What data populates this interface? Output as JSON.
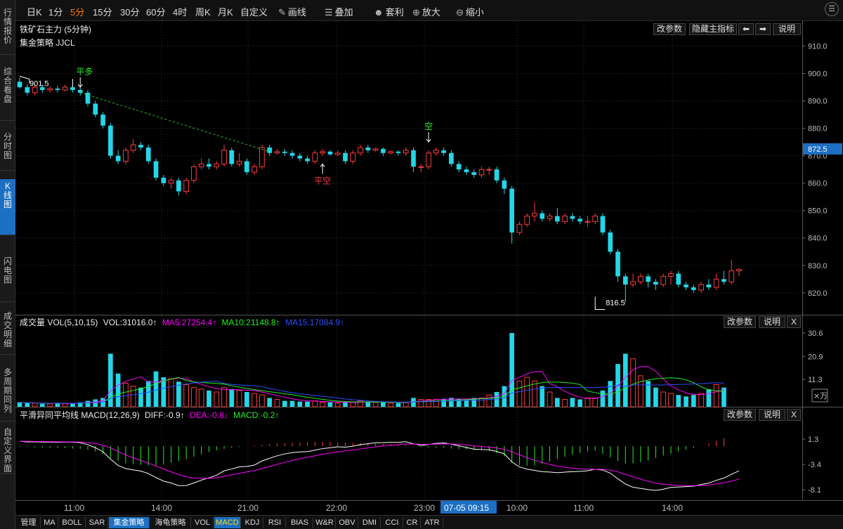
{
  "nav": {
    "tabs": [
      {
        "label": "行情报价",
        "active": false
      },
      {
        "label": "综合看盘",
        "active": false
      },
      {
        "label": "分时图",
        "active": false
      },
      {
        "label": "K线图",
        "active": true
      },
      {
        "label": "闪电图",
        "active": false
      },
      {
        "label": "成交明细",
        "active": false
      },
      {
        "label": "多周期同列",
        "active": false
      },
      {
        "label": "自定义界面",
        "active": false
      }
    ]
  },
  "toolbar": {
    "periods": [
      "日K",
      "1分",
      "5分",
      "15分",
      "30分",
      "60分",
      "4时",
      "周K",
      "月K",
      "自定义"
    ],
    "selected_period": "5分",
    "tools": [
      {
        "label": "画线",
        "icon": "pencil-icon",
        "glyph": "✎"
      },
      {
        "label": "叠加",
        "icon": "layers-icon",
        "glyph": "☰"
      },
      {
        "label": "套利",
        "icon": "arbitrage-icon",
        "glyph": "☻"
      },
      {
        "label": "放大",
        "icon": "zoom-in-icon",
        "glyph": "⊕"
      },
      {
        "label": "缩小",
        "icon": "zoom-out-icon",
        "glyph": "⊖"
      }
    ],
    "menu_glyph": "☰"
  },
  "main_panel": {
    "title": "铁矿石主力 (5分钟)",
    "strategy": "集金策略 JJCL",
    "buttons": {
      "params": "改参数",
      "hide": "隐藏主指标",
      "left": "⬅",
      "right": "➡",
      "help": "说明"
    },
    "y_ticks": [
      "910.0",
      "900.0",
      "890.0",
      "880.0",
      "870.0",
      "860.0",
      "850.0",
      "840.0",
      "830.0",
      "820.0"
    ],
    "current_price": "872.5",
    "high_label": "901.5",
    "low_label": "816.5",
    "signals": [
      "平多",
      "平空",
      "空"
    ]
  },
  "vol_panel": {
    "label": "成交量 VOL(5,10,15)",
    "vol": "VOL:31016.0↑",
    "ma5": "MA5:27254.4↑",
    "ma10": "MA10:21148.8↑",
    "ma15": "MA15:17084.9↑",
    "buttons": {
      "params": "改参数",
      "help": "说明",
      "close": "X"
    },
    "y_ticks": [
      "30.6",
      "20.9",
      "11.3"
    ],
    "unit": "×万"
  },
  "macd_panel": {
    "label": "平滑异同平均线 MACD(12,26,9)",
    "diff": "DIFF:-0.9↑",
    "dea": "DEA:-0.8↓",
    "macd": "MACD:-0.2↑",
    "buttons": {
      "params": "改参数",
      "help": "说明",
      "close": "X"
    },
    "y_ticks": [
      "1.3",
      "-3.4",
      "-8.1"
    ]
  },
  "x_axis": {
    "ticks": [
      "11:00",
      "14:00",
      "21:00",
      "22:00",
      "23:00",
      "10:00",
      "11:00",
      "14:00"
    ],
    "cursor_label": "07-05 09:15"
  },
  "bottom_tabs": [
    {
      "label": "管理",
      "hl": false
    },
    {
      "label": "MA",
      "hl": false
    },
    {
      "label": "BOLL",
      "hl": false
    },
    {
      "label": "SAR",
      "hl": false
    },
    {
      "label": "集金策略",
      "hl": true
    },
    {
      "label": "海龟策略",
      "hl": false
    },
    {
      "label": "VOL",
      "hl": false
    },
    {
      "label": "MACD",
      "hl": "yellow"
    },
    {
      "label": "KDJ",
      "hl": false
    },
    {
      "label": "RSI",
      "hl": false
    },
    {
      "label": "BIAS",
      "hl": false
    },
    {
      "label": "W&R",
      "hl": false
    },
    {
      "label": "OBV",
      "hl": false
    },
    {
      "label": "DMI",
      "hl": false
    },
    {
      "label": "CCI",
      "hl": false
    },
    {
      "label": "CR",
      "hl": false
    },
    {
      "label": "ATR",
      "hl": false
    }
  ],
  "colors": {
    "up": "#ff3b3b",
    "down": "#23d6e8",
    "ma5": "#ff00ff",
    "ma10": "#22ee22",
    "ma15": "#2a4fff",
    "accent": "#1c6fc2",
    "selected": "#ff7a00",
    "signal_green": "#22ee22",
    "signal_red": "#ff3b3b"
  },
  "chart_data": {
    "type": "candlestick",
    "price_range": [
      812,
      914
    ],
    "candles": [
      [
        897,
        895,
        898.5,
        894.5
      ],
      [
        895,
        893,
        896,
        892
      ],
      [
        893,
        895,
        896,
        892
      ],
      [
        895,
        894,
        896,
        893
      ],
      [
        894,
        894.5,
        895.5,
        893
      ],
      [
        894.5,
        894,
        895.5,
        893
      ],
      [
        894,
        895,
        896,
        893.5
      ],
      [
        895,
        894,
        896,
        893
      ],
      [
        894,
        893,
        895,
        892
      ],
      [
        893,
        889,
        894,
        888
      ],
      [
        889,
        885,
        890,
        884
      ],
      [
        885,
        881,
        886,
        880
      ],
      [
        881,
        870,
        882,
        869
      ],
      [
        870,
        868,
        872,
        867
      ],
      [
        868,
        872,
        873,
        867
      ],
      [
        872,
        874,
        876,
        871
      ],
      [
        874,
        873,
        875,
        872
      ],
      [
        873,
        868,
        874,
        867
      ],
      [
        868,
        862,
        869,
        861
      ],
      [
        862,
        860,
        863,
        859
      ],
      [
        860,
        861,
        862,
        858
      ],
      [
        861,
        857,
        862,
        855.5
      ],
      [
        857,
        861,
        862,
        856
      ],
      [
        861,
        866,
        867,
        860
      ],
      [
        866,
        867,
        869,
        865
      ],
      [
        867,
        866,
        869,
        865
      ],
      [
        866,
        867,
        868,
        865
      ],
      [
        867,
        872,
        874,
        866
      ],
      [
        872,
        867,
        873,
        866
      ],
      [
        867,
        868,
        871,
        866
      ],
      [
        868,
        864,
        869,
        863
      ],
      [
        864,
        866,
        867,
        863
      ],
      [
        866,
        873,
        874,
        865
      ],
      [
        873,
        871,
        874,
        870
      ],
      [
        871,
        871.5,
        872.5,
        870.5
      ],
      [
        871.5,
        871,
        872.5,
        870
      ],
      [
        871,
        870,
        872,
        869
      ],
      [
        870,
        869,
        871,
        868
      ],
      [
        869,
        868,
        870,
        867
      ],
      [
        868,
        871,
        872,
        867
      ],
      [
        871,
        871.5,
        872.5,
        870
      ],
      [
        871.5,
        870.5,
        872,
        870
      ],
      [
        870.5,
        871,
        872,
        870
      ],
      [
        871,
        868,
        872,
        867
      ],
      [
        868,
        871,
        872,
        867
      ],
      [
        871,
        873,
        874,
        870
      ],
      [
        873,
        872,
        874,
        871
      ],
      [
        872,
        872.5,
        873,
        871.5
      ],
      [
        872.5,
        871,
        873,
        870
      ],
      [
        871,
        871.5,
        872,
        870.5
      ],
      [
        871.5,
        871,
        872,
        870
      ],
      [
        871,
        872,
        873,
        870
      ],
      [
        872,
        866,
        873,
        864
      ],
      [
        866,
        866,
        867,
        864
      ],
      [
        866,
        871,
        872,
        865
      ],
      [
        871,
        872,
        873,
        870
      ],
      [
        872,
        871,
        873,
        870
      ],
      [
        871,
        867,
        872,
        866
      ],
      [
        867,
        865,
        868,
        864
      ],
      [
        865,
        864,
        866,
        863
      ],
      [
        864,
        863,
        865,
        862
      ],
      [
        863,
        865,
        866,
        862
      ],
      [
        865,
        865,
        866,
        863
      ],
      [
        865,
        861,
        866,
        860
      ],
      [
        861,
        858,
        862,
        856
      ],
      [
        858,
        842,
        859,
        838
      ],
      [
        842,
        845,
        846,
        841
      ],
      [
        845,
        848,
        849,
        844
      ],
      [
        848,
        849,
        853,
        846
      ],
      [
        849,
        847,
        850,
        846
      ],
      [
        847,
        848,
        849,
        846
      ],
      [
        848,
        846,
        851,
        845
      ],
      [
        846,
        848,
        849,
        845
      ],
      [
        848,
        847,
        849,
        846
      ],
      [
        847,
        846,
        848,
        845
      ],
      [
        846,
        846,
        848,
        844
      ],
      [
        846,
        848,
        849,
        845
      ],
      [
        848,
        842,
        849,
        841
      ],
      [
        842,
        835,
        843,
        834
      ],
      [
        835,
        826,
        836,
        824
      ],
      [
        826,
        823,
        827,
        816.5
      ],
      [
        823,
        824,
        827,
        822
      ],
      [
        824,
        826,
        827,
        823
      ],
      [
        826,
        824,
        827,
        822
      ],
      [
        824,
        823,
        825,
        821
      ],
      [
        823,
        826,
        827,
        822
      ],
      [
        826,
        827,
        828,
        823
      ],
      [
        827,
        823,
        828,
        822
      ],
      [
        823,
        822,
        824,
        821
      ],
      [
        822,
        821,
        823,
        820
      ],
      [
        821,
        823,
        824,
        820
      ],
      [
        823,
        822,
        825,
        821
      ],
      [
        822,
        825,
        827,
        821
      ],
      [
        825,
        824,
        828,
        823
      ],
      [
        824,
        828,
        832,
        823
      ],
      [
        828,
        828.5,
        829,
        826
      ]
    ],
    "vol_ratio": [
      0.06,
      0.05,
      0.05,
      0.04,
      0.04,
      0.05,
      0.04,
      0.05,
      0.06,
      0.08,
      0.1,
      0.12,
      0.72,
      0.45,
      0.32,
      0.28,
      0.26,
      0.35,
      0.48,
      0.4,
      0.38,
      0.34,
      0.3,
      0.26,
      0.24,
      0.22,
      0.2,
      0.26,
      0.24,
      0.22,
      0.2,
      0.18,
      0.16,
      0.12,
      0.1,
      0.08,
      0.08,
      0.07,
      0.07,
      0.08,
      0.06,
      0.06,
      0.05,
      0.06,
      0.06,
      0.08,
      0.07,
      0.06,
      0.06,
      0.05,
      0.05,
      0.06,
      0.12,
      0.1,
      0.1,
      0.1,
      0.1,
      0.12,
      0.11,
      0.1,
      0.12,
      0.12,
      0.16,
      0.2,
      0.28,
      1.0,
      0.35,
      0.4,
      0.35,
      0.28,
      0.2,
      0.12,
      0.1,
      0.12,
      0.1,
      0.12,
      0.12,
      0.22,
      0.35,
      0.58,
      0.72,
      0.65,
      0.42,
      0.35,
      0.26,
      0.2,
      0.18,
      0.16,
      0.14,
      0.16,
      0.18,
      0.24,
      0.3,
      0.26
    ],
    "macd_hist": [
      -0.2,
      -0.3,
      -0.4,
      -0.5,
      -0.6,
      -0.6,
      -0.7,
      -0.8,
      -0.9,
      -1.2,
      -1.8,
      -2.6,
      -4.0,
      -5.0,
      -5.8,
      -6.1,
      -6.3,
      -6.5,
      -6.6,
      -6.2,
      -5.6,
      -5.0,
      -4.4,
      -3.6,
      -2.8,
      -2.0,
      -1.4,
      -0.9,
      -0.5,
      -0.2,
      0.1,
      0.3,
      0.5,
      0.7,
      0.9,
      1.0,
      1.1,
      1.2,
      1.3,
      1.4,
      1.4,
      1.4,
      1.3,
      1.2,
      1.1,
      1.0,
      1.0,
      0.9,
      0.8,
      0.7,
      0.5,
      0.3,
      -0.1,
      -0.4,
      -0.5,
      -0.6,
      -0.6,
      -0.8,
      -1.0,
      -1.1,
      -1.2,
      -1.2,
      -1.6,
      -2.4,
      -3.4,
      -5.6,
      -6.4,
      -6.6,
      -6.5,
      -6.0,
      -5.2,
      -4.4,
      -3.6,
      -2.9,
      -2.3,
      -1.8,
      -1.6,
      -2.6,
      -3.8,
      -5.0,
      -5.8,
      -5.8,
      -5.4,
      -4.8,
      -4.0,
      -3.2,
      -2.5,
      -1.8,
      -1.2,
      -0.6,
      0.1,
      0.9,
      1.8,
      2.6
    ]
  }
}
